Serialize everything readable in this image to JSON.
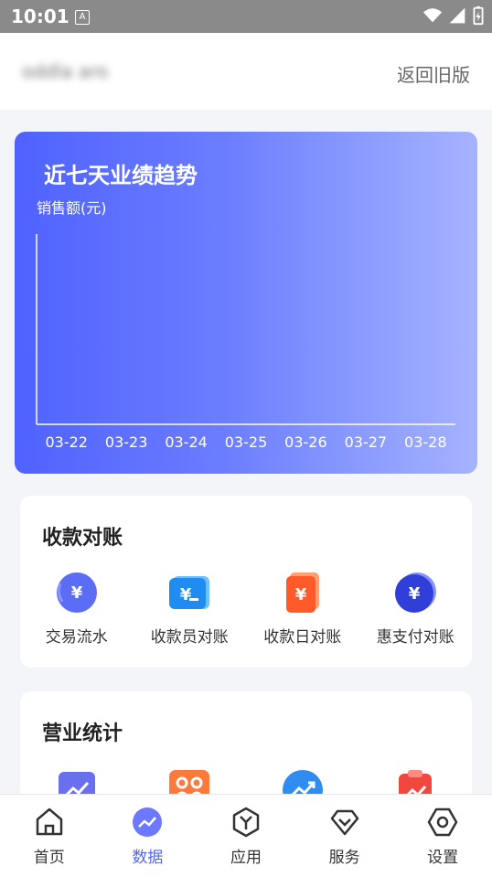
{
  "status_bar": {
    "time": "10:01",
    "notif_letter": "A"
  },
  "header": {
    "store_name": "oddla aro",
    "back_label": "返回旧版"
  },
  "trend": {
    "title": "近七天业绩趋势",
    "unit_label": "销售额(元)",
    "chart_data": {
      "type": "line",
      "title": "近七天业绩趋势",
      "ylabel": "销售额(元)",
      "categories": [
        "03-22",
        "03-23",
        "03-24",
        "03-25",
        "03-26",
        "03-27",
        "03-28"
      ],
      "series": [],
      "grid": false
    }
  },
  "reconcile": {
    "title": "收款对账",
    "items": [
      {
        "label": "交易流水",
        "icon": "transaction-flow-icon",
        "color": "#5b6cf5"
      },
      {
        "label": "收款员对账",
        "icon": "cashier-reconcile-icon",
        "color": "#1e8cf0"
      },
      {
        "label": "收款日对账",
        "icon": "daily-reconcile-icon",
        "color": "#ff6a3d"
      },
      {
        "label": "惠支付对账",
        "icon": "hui-pay-reconcile-icon",
        "color": "#3f4fe0"
      }
    ]
  },
  "business": {
    "title": "营业统计",
    "items": [
      {
        "icon": "stats-chart-icon",
        "color": "#6a6ff0"
      },
      {
        "icon": "grid-apps-icon",
        "color": "#ff7a3a"
      },
      {
        "icon": "trend-up-icon",
        "color": "#2f8cf0"
      },
      {
        "icon": "clipboard-chart-icon",
        "color": "#f0483e"
      }
    ]
  },
  "tabbar": {
    "items": [
      {
        "label": "首页",
        "icon": "home-icon",
        "active": false
      },
      {
        "label": "数据",
        "icon": "data-trend-icon",
        "active": true
      },
      {
        "label": "应用",
        "icon": "apps-icon",
        "active": false
      },
      {
        "label": "服务",
        "icon": "service-icon",
        "active": false
      },
      {
        "label": "设置",
        "icon": "settings-icon",
        "active": false
      }
    ]
  }
}
